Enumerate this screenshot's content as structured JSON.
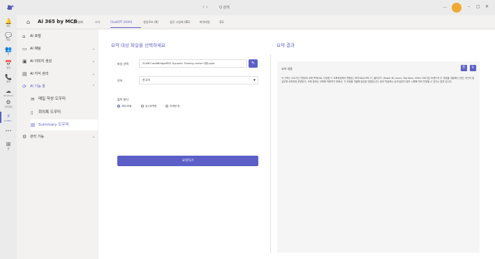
{
  "titlebar": {
    "nav": "‹ ›",
    "search_text": "Q 검색",
    "winctl": [
      "…",
      "–",
      "▢",
      "✕"
    ]
  },
  "rail": {
    "items": [
      {
        "icon": "♫",
        "label": ""
      },
      {
        "icon": "🔔",
        "label": "활동"
      },
      {
        "icon": "💬",
        "label": "채팅"
      },
      {
        "icon": "👥",
        "label": "팀"
      },
      {
        "icon": "📅",
        "label": "일정"
      },
      {
        "icon": "📞",
        "label": "통화"
      },
      {
        "icon": "☁",
        "label": "OneDrive"
      },
      {
        "icon": "⚙",
        "label": "코파일럿"
      },
      {
        "icon": "⚡",
        "label": "AI 365..."
      },
      {
        "icon": "•••",
        "label": ""
      },
      {
        "icon": "⊞",
        "label": "앱"
      }
    ]
  },
  "header": {
    "title": "Ai 365 by MCB",
    "tabs": [
      "업자설제",
      "소식",
      "ChatGPT (AOAI)",
      "생성모조 (B)",
      "업무 시일회 (BE)",
      "파이버일",
      "정도"
    ]
  },
  "sidebar": {
    "items": [
      {
        "label": "AI 포털",
        "chev": ""
      },
      {
        "label": "AI 채팅",
        "chev": "⌄"
      },
      {
        "label": "AI 이미지 생성",
        "chev": "⌄"
      },
      {
        "label": "AI 지식 관리",
        "chev": "⌄"
      },
      {
        "label": "AI 기능 툴",
        "chev": "⌃"
      }
    ],
    "subitems": [
      {
        "label": "메일 작성 도우미"
      },
      {
        "label": "회의록 도우미"
      },
      {
        "label": "Summary 도우미"
      }
    ],
    "bottom_item": {
      "label": "관리 기능",
      "chev": "⌄"
    }
  },
  "main": {
    "left_title": "요약 대상 파일을 선택하세요",
    "right_title": "요약 결과",
    "file_label": "파일 선택",
    "file_value": "52d9FCreditBridgeRSO Dynamic Training center 대한.pptx",
    "lang_label": "언어",
    "lang_value": "한국어",
    "type_label": "출력 형식",
    "radios": [
      "개요/요점",
      "임시요약문",
      "자세한 정"
    ],
    "summary_button": "요약하기",
    "result_label": "요약 내용",
    "result_text": "이 구조는 2023년 7월부터 교육 목적으로, 다양한 IT 교육과정에서 활용된, 마이크로소프트 IT, 클라우드 (Power BI, Azure, Big Data, Office 365 등) 트렌드의 주 과정을 개발해서 관련, 최근의 및 실무형 교육과정 운영방식, 교육 결과는 교육에 적용하기 위해서, 각 과정을 개발해 달성된 방법입니다. 동의 학습에는 상세 일정이 별도 시행에 따라 반영될 수 있다는 결과 입니다."
  },
  "colors": {
    "accent": "#5b5fc7",
    "sidebar_bg": "#f3f2f1",
    "result_bg": "#f5f5f5"
  }
}
